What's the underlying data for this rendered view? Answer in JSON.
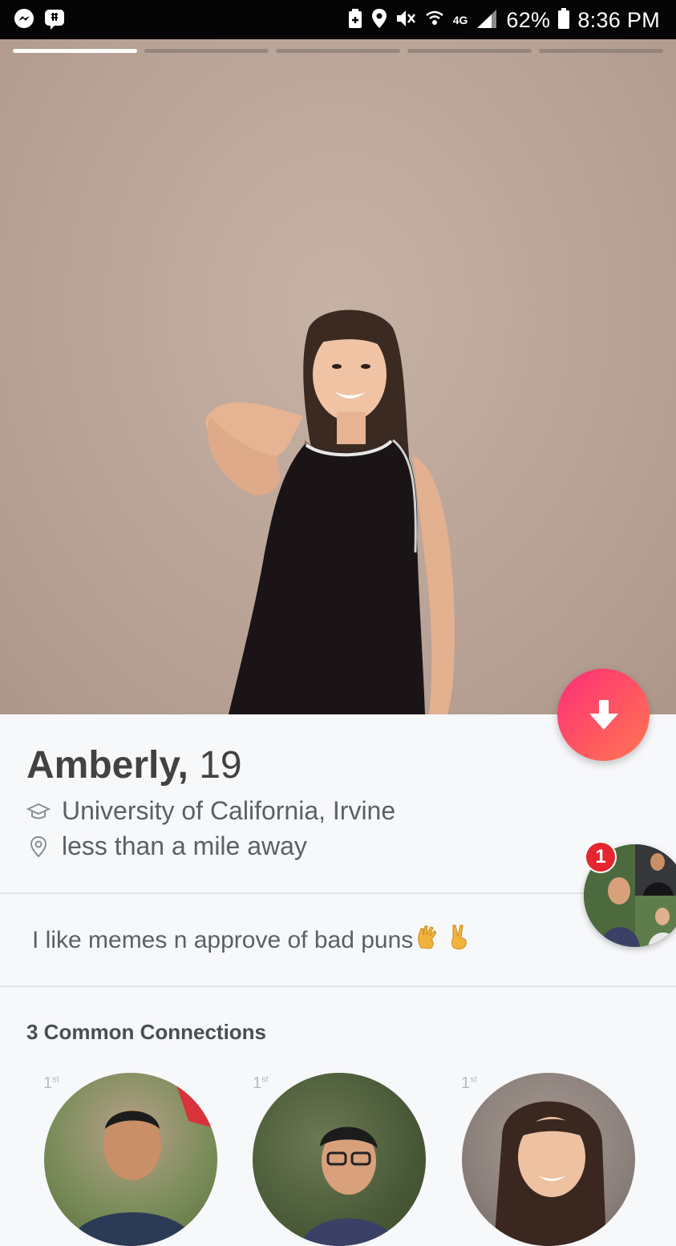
{
  "status_bar": {
    "battery_percent": "62%",
    "time": "8:36 PM",
    "left_icons": [
      "messenger-icon",
      "chat-app-icon"
    ],
    "right_icons": [
      "battery-saver-icon",
      "location-icon",
      "mute-icon",
      "wifi-icon",
      "lte-icon",
      "signal-icon",
      "battery-icon"
    ],
    "network": "4G"
  },
  "photo": {
    "count": 5,
    "active_index": 0
  },
  "profile": {
    "name": "Amberly,",
    "age": "19",
    "school": "University of California, Irvine",
    "distance": "less than a mile away",
    "bio": "I like memes n approve of bad puns",
    "bio_emojis": [
      "vulcan-salute-icon",
      "victory-hand-icon"
    ]
  },
  "fab": {
    "icon": "arrow-down-icon",
    "color": "#fd3a70"
  },
  "common_connections": {
    "title": "3 Common Connections",
    "badge_count": "1",
    "items": [
      {
        "degree": "1",
        "degree_suffix": "st"
      },
      {
        "degree": "1",
        "degree_suffix": "st"
      },
      {
        "degree": "1",
        "degree_suffix": "st"
      }
    ]
  },
  "colors": {
    "accent": "#fd3a70",
    "text_dark": "#424242",
    "text_muted": "#5b5f66",
    "background": "#f7f8fa"
  }
}
